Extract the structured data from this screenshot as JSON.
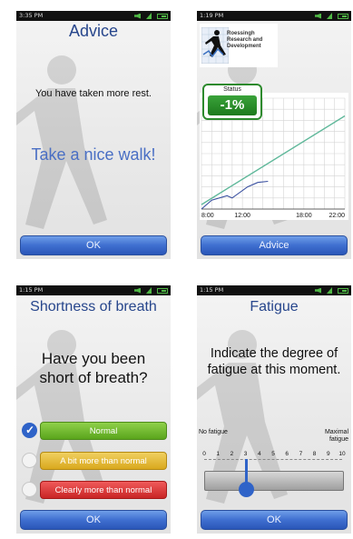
{
  "screen1": {
    "time": "3:35 PM",
    "title": "Advice",
    "message": "You have taken more rest.",
    "advice": "Take a nice walk!",
    "ok_label": "OK"
  },
  "screen2": {
    "time": "1:19 PM",
    "logo_text": "Roessingh\nResearch and\nDevelopment",
    "status_label": "Status",
    "status_value": "-1%",
    "advice_button": "Advice",
    "chart_data": {
      "type": "line",
      "x_tick_labels": [
        "8:00",
        "12:00",
        "18:00",
        "22:00"
      ],
      "series": [
        {
          "color": "#5fb89a",
          "points": [
            [
              8,
              2
            ],
            [
              22,
              42
            ]
          ]
        },
        {
          "color": "#3a50a0",
          "points": [
            [
              8,
              0
            ],
            [
              9,
              4
            ],
            [
              10.5,
              6
            ],
            [
              11,
              5
            ],
            [
              12.5,
              10
            ],
            [
              13.5,
              12
            ],
            [
              14.5,
              12.5
            ]
          ]
        }
      ],
      "xlim": [
        8,
        22
      ],
      "ylim": [
        0,
        50
      ],
      "grid": true
    }
  },
  "screen3": {
    "time": "1:15 PM",
    "title": "Shortness of breath",
    "question": "Have you been short of breath?",
    "options": [
      {
        "label": "Normal",
        "checked": true
      },
      {
        "label": "A bit more than normal",
        "checked": false
      },
      {
        "label": "Clearly more than normal",
        "checked": false
      }
    ],
    "ok_label": "OK"
  },
  "screen4": {
    "time": "1:15 PM",
    "title": "Fatigue",
    "instruction": "Indicate the degree of fatigue at this moment.",
    "min_label": "No fatigue",
    "max_label": "Maximal fatigue",
    "scale_numbers": [
      "0",
      "1",
      "2",
      "3",
      "4",
      "5",
      "6",
      "7",
      "8",
      "9",
      "10"
    ],
    "selected_value": 3,
    "ok_label": "OK"
  }
}
